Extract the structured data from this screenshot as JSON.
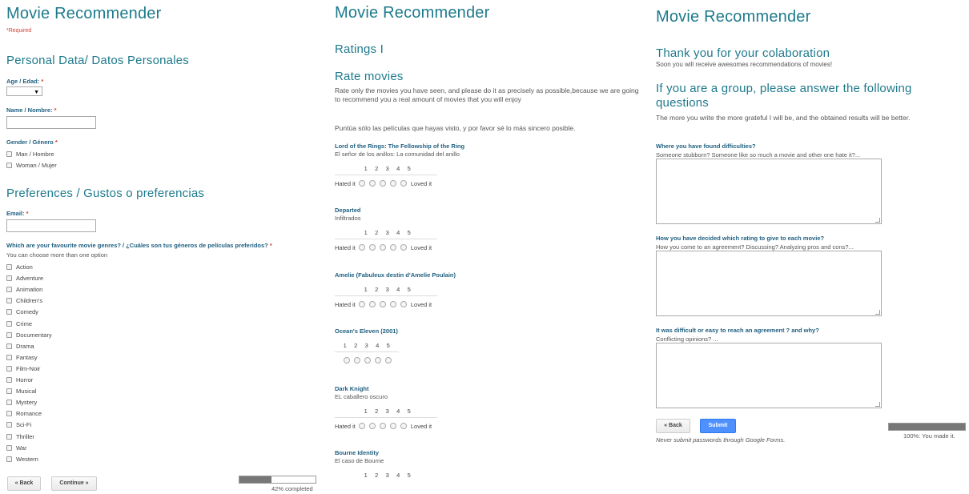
{
  "page1": {
    "title": "Movie Recommender",
    "required_note": "*Required",
    "section1": "Personal Data/ Datos Personales",
    "age_label": "Age / Edad:",
    "name_label": "Name / Nombre:",
    "gender_label": "Gender / Género",
    "gender_options": [
      "Man / Hombre",
      "Woman / Mujer"
    ],
    "section2": "Preferences / Gustos o preferencias",
    "email_label": "Email:",
    "genres_label": "Which are your favourite movie genres? / ¿Cuáles son tus géneros de películas preferidos?",
    "genres_help": "You can choose more than one option",
    "genres": [
      "Action",
      "Adventure",
      "Animation",
      "Children's",
      "Comedy",
      "Crime",
      "Documentary",
      "Drama",
      "Fantasy",
      "Film-Noir",
      "Horror",
      "Musical",
      "Mystery",
      "Romance",
      "Sci-Fi",
      "Thriller",
      "War",
      "Western"
    ],
    "back_label": "« Back",
    "continue_label": "Continue »",
    "progress_text": "42% completed",
    "progress": 0.42,
    "asterisk": "*"
  },
  "page2": {
    "title": "Movie Recommender",
    "subtitle": "Ratings I",
    "section": "Rate movies",
    "intro_en": "Rate only the movies you have seen, and please do it as precisely as possible,because we are going to recommend you a real amount of movies that you will enjoy",
    "intro_es": "Puntúa sólo las películas que hayas visto, y por favor sé lo más sincero  posible.",
    "scale": [
      "1",
      "2",
      "3",
      "4",
      "5"
    ],
    "low_label": "Hated it",
    "high_label": "Loved it",
    "movies": [
      {
        "title": "Lord of the Rings: The Fellowship of the Ring",
        "subtitle": "El señor de los anillos: La comunidad del anillo"
      },
      {
        "title": "Departed",
        "subtitle": "Infiltrados"
      },
      {
        "title": "Amelie (Fabuleux destin d'Amelie Poulain)",
        "subtitle": ""
      },
      {
        "title": "Ocean's Eleven (2001)",
        "subtitle": ""
      },
      {
        "title": "Dark Knight",
        "subtitle": "EL caballero oscuro"
      },
      {
        "title": "Bourne Identity",
        "subtitle": "El caso de Bourne"
      }
    ]
  },
  "page3": {
    "title": "Movie Recommender",
    "thanks_title": "Thank you for your colaboration",
    "thanks_text": "Soon you will receive awesomes recommendations of movies!",
    "group_title": "If you are a group, please answer the following questions",
    "group_text": "The more you write the more grateful I will be, and the obtained results will be better.",
    "questions": [
      {
        "label": "Where you have found difficulties?",
        "help": "Someone stubborn? Someone like so much a movie and other one hate it?..."
      },
      {
        "label": "How you have decided which rating to give to each movie?",
        "help": "How you come to an agreement? Discussing? Analyzing pros and cons?..."
      },
      {
        "label": "It was difficult or easy to reach an agreement ? and why?",
        "help": "Conflicting opinions? ..."
      }
    ],
    "back_label": "« Back",
    "submit_label": "Submit",
    "footer_note": "Never submit passwords through Google Forms.",
    "progress_text": "100%: You made it.",
    "progress": 1.0
  }
}
